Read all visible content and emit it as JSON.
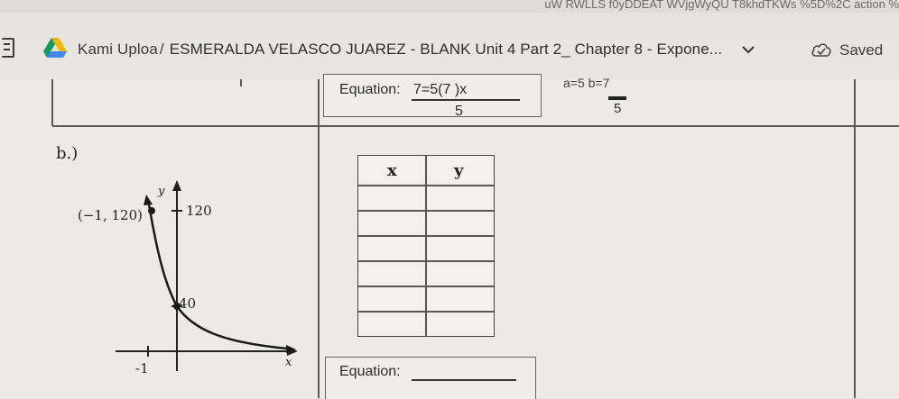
{
  "browser": {
    "url_fragment": "uW RWLLS f0yDDEAT WVjgWyQU T8khdTKWs %5D%2C action %"
  },
  "header": {
    "app_name": "Kami Uploa",
    "separator": "/",
    "doc_name": "ESMERALDA VELASCO JUAREZ - BLANK Unit 4 Part 2_ Chapter 8 - Expone...",
    "status": "Saved"
  },
  "worksheet": {
    "top_equation": {
      "label": "Equation:",
      "value": "7=5(7 )x",
      "denominator": "5"
    },
    "side_note": {
      "ab": "a=5  b=7",
      "denominator": "5"
    },
    "part_b": {
      "label": "b.)",
      "graph": {
        "y_axis_label": "y",
        "x_axis_label": "x",
        "point_label": "(−1, 120)",
        "tick_120": "120",
        "tick_40": "40",
        "tick_neg1": "-1"
      },
      "table": {
        "headers": [
          "x",
          "y"
        ],
        "rows": [
          [
            "",
            ""
          ],
          [
            "",
            ""
          ],
          [
            "",
            ""
          ],
          [
            "",
            ""
          ],
          [
            "",
            ""
          ],
          [
            "",
            ""
          ]
        ]
      },
      "equation": {
        "label": "Equation:",
        "value": ""
      }
    }
  },
  "colors": {
    "page_bg": "#eceae5",
    "header_bg": "#e6e5e0",
    "line": "#5a5a5a"
  },
  "icons": [
    "menu-icon",
    "google-drive-icon",
    "chevron-down-icon",
    "cloud-check-icon"
  ]
}
